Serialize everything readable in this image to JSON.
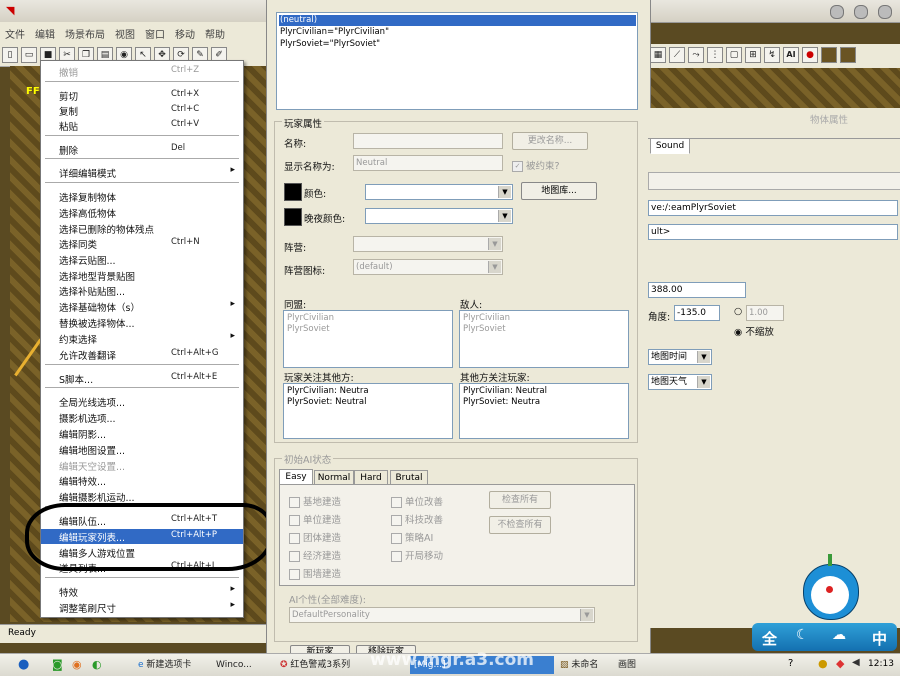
{
  "menubar": [
    "文件",
    "编辑",
    "场景布局",
    "视图",
    "窗口",
    "移动",
    "帮助"
  ],
  "context_menu": {
    "items": [
      {
        "label": "撤销",
        "shortcut": "Ctrl+Z",
        "state": "disabled"
      },
      {
        "label": "剪切",
        "shortcut": "Ctrl+X"
      },
      {
        "label": "复制",
        "shortcut": "Ctrl+C"
      },
      {
        "label": "粘贴",
        "shortcut": "Ctrl+V"
      },
      {
        "label": "删除",
        "shortcut": "Del"
      },
      {
        "label": "详细编辑模式",
        "arrow": true
      },
      {
        "label": "选择复制物体"
      },
      {
        "label": "选择高低物体"
      },
      {
        "label": "选择已删除的物体残点"
      },
      {
        "label": "选择同类",
        "shortcut": "Ctrl+N"
      },
      {
        "label": "选择云贴图..."
      },
      {
        "label": "选择地型背景贴图"
      },
      {
        "label": "选择补贴贴图..."
      },
      {
        "label": "选择基础物体（s）",
        "arrow": true
      },
      {
        "label": "替换被选择物体..."
      },
      {
        "label": "约束选择",
        "arrow": true
      },
      {
        "label": "允许改善翻译",
        "shortcut": "Ctrl+Alt+G"
      },
      {
        "label": "S脚本...",
        "shortcut": "Ctrl+Alt+E"
      },
      {
        "label": "全局光线选项..."
      },
      {
        "label": "摄影机选项..."
      },
      {
        "label": "编辑阴影..."
      },
      {
        "label": "编辑地图设置..."
      },
      {
        "label": "编辑天空设置...",
        "state": "disabled"
      },
      {
        "label": "编辑特效..."
      },
      {
        "label": "编辑摄影机运动..."
      },
      {
        "label": "编辑队伍...",
        "shortcut": "Ctrl+Alt+T"
      },
      {
        "label": "编辑玩家列表...",
        "shortcut": "Ctrl+Alt+P",
        "state": "selected"
      },
      {
        "label": "编辑多人游戏位置"
      },
      {
        "label": "道具列表...",
        "shortcut": "Ctrl+Alt+I"
      },
      {
        "label": "特效",
        "arrow": true
      },
      {
        "label": "调整笔刷尺寸",
        "arrow": true
      }
    ]
  },
  "player_dialog": {
    "players": [
      "(neutral)",
      "PlyrCivilian=\"PlyrCivilian\"",
      "PlyrSoviet=\"PlyrSoviet\""
    ],
    "props_group": "玩家属性",
    "name_label": "名称:",
    "rename_button": "更改名称...",
    "display_name_label": "显示名称为:",
    "display_name_value": "Neutral",
    "is_human_label": "被约束?",
    "color_label": "颜色:",
    "color_picker_button": "地图库...",
    "night_color_label": "晚夜颜色:",
    "faction_label": "阵营:",
    "faction_icon_label": "阵营图标:",
    "faction_icon_value": "(default)",
    "allies_label": "同盟:",
    "allies": [
      "PlyrCivilian",
      "PlyrSoviet"
    ],
    "enemies_label": "敌人:",
    "enemies": [
      "PlyrCivilian",
      "PlyrSoviet"
    ],
    "regard_others_label": "玩家关注其他方:",
    "regard_others": [
      "PlyrCivilian: Neutra",
      "PlyrSoviet: Neutral"
    ],
    "others_regard_label": "其他方关注玩家:",
    "others_regard": [
      "PlyrCivilian: Neutral",
      "PlyrSoviet: Neutra"
    ],
    "ai_group": "初始AI状态",
    "ai_tabs": [
      "Easy",
      "Normal",
      "Hard",
      "Brutal"
    ],
    "ai_checks_left": [
      "基地建造",
      "单位建造",
      "团体建造",
      "经济建造",
      "围墙建造"
    ],
    "ai_checks_right": [
      "单位改善",
      "科技改善",
      "策略AI",
      "开局移动"
    ],
    "check_all_button": "检查所有",
    "uncheck_all_button": "不检查所有",
    "ai_personality_label": "AI个性(全部难度):",
    "ai_personality_value": "DefaultPersonality",
    "bottom_btn1": "新玩家",
    "bottom_btn2": "移除玩家"
  },
  "right_panel": {
    "title": "物体属性",
    "tab_sound": "Sound",
    "team_value": "ve:/:eamPlyrSoviet",
    "field2": "ult>",
    "number_value": "388.00",
    "angle_label": "角度:",
    "angle_value": "-135.0",
    "scale_value": "1.00",
    "no_scale_label": "不缩放",
    "time_label": "地图时间",
    "weather_label": "地图天气"
  },
  "status_text": "Ready",
  "taskbar": {
    "items": [
      "新建选项卡",
      "Winco...",
      "红色警戒3系列",
      "[Mig...]",
      "未命名",
      "画图"
    ],
    "time": "12:13"
  },
  "weather_widget": {
    "left": "全",
    "right": "中"
  },
  "watermark": "www.mgr.a3.com",
  "map_label": "FF"
}
